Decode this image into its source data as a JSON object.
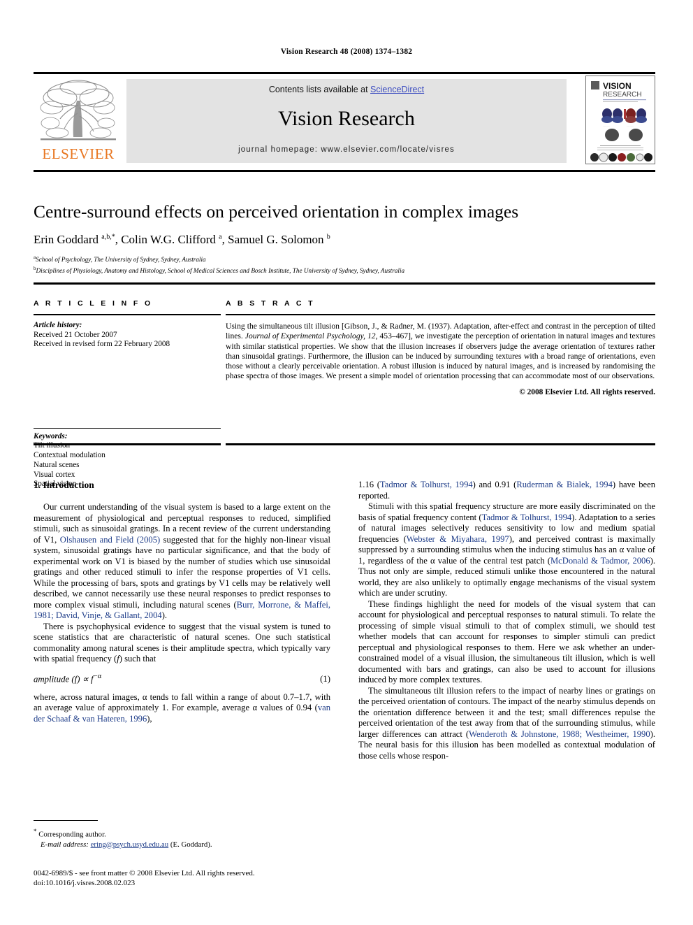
{
  "running_head": "Vision Research 48 (2008) 1374–1382",
  "masthead": {
    "publisher_logo_label": "ELSEVIER",
    "contents_prefix": "Contents lists available at ",
    "contents_link": "ScienceDirect",
    "journal_name": "Vision Research",
    "homepage_line": "journal homepage: www.elsevier.com/locate/visres",
    "cover": {
      "title_line1": "VISION",
      "title_line2": "RESEARCH"
    },
    "link_color": "#3B4CC0",
    "elsevier_orange": "#E87722"
  },
  "article": {
    "title": "Centre-surround effects on perceived orientation in complex images",
    "authors_html": "Erin Goddard <sup>a,b,*</sup>, Colin W.G. Clifford <sup>a</sup>, Samuel G. Solomon <sup>b</sup>",
    "affiliation_a": "School of Psychology, The University of Sydney, Sydney, Australia",
    "affiliation_b": "Disciplines of Physiology, Anatomy and Histology, School of Medical Sciences and Bosch Institute, The University of Sydney, Sydney, Australia"
  },
  "article_info": {
    "heading": "A R T I C L E  I N F O",
    "history_label": "Article history:",
    "history_lines": [
      "Received 21 October 2007",
      "Received in revised form 22 February 2008"
    ],
    "keywords_label": "Keywords:",
    "keywords": [
      "Tilt illusion",
      "Contextual modulation",
      "Natural scenes",
      "Visual cortex",
      "Spatial vision"
    ]
  },
  "abstract": {
    "heading": "A B S T R A C T",
    "text_html": "Using the simultaneous tilt illusion [Gibson, J., &amp; Radner, M. (1937). Adaptation, after-effect and contrast in the perception of tilted lines. <em>Journal of Experimental Psychology, 12</em>, 453–467], we investigate the perception of orientation in natural images and textures with similar statistical properties. We show that the illusion increases if observers judge the average orientation of textures rather than sinusoidal gratings. Furthermore, the illusion can be induced by surrounding textures with a broad range of orientations, even those without a clearly perceivable orientation. A robust illusion is induced by natural images, and is increased by randomising the phase spectra of those images. We present a simple model of orientation processing that can accommodate most of our observations.",
    "copyright": "© 2008 Elsevier Ltd. All rights reserved."
  },
  "body": {
    "section_title": "1. Introduction",
    "left_paragraphs_html": [
      "Our current understanding of the visual system is based to a large extent on the measurement of physiological and perceptual responses to reduced, simplified stimuli, such as sinusoidal gratings. In a recent review of the current understanding of V1, <span class=\"cite\">Olshausen and Field (2005)</span> suggested that for the highly non-linear visual system, sinusoidal gratings have no particular significance, and that the body of experimental work on V1 is biased by the number of studies which use sinusoidal gratings and other reduced stimuli to infer the response properties of V1 cells. While the processing of bars, spots and gratings by V1 cells may be relatively well described, we cannot necessarily use these neural responses to predict responses to more complex visual stimuli, including natural scenes (<span class=\"cite\">Burr, Morrone, &amp; Maffei, 1981; David, Vinje, &amp; Gallant, 2004</span>).",
      "There is psychophysical evidence to suggest that the visual system is tuned to scene statistics that are characteristic of natural scenes. One such statistical commonality among natural scenes is their amplitude spectra, which typically vary with spatial frequency (<em>f</em>) such that"
    ],
    "equation": {
      "body_html": "amplitude (f) &prop; f<sup>&minus;&alpha;</sup>",
      "number": "(1)"
    },
    "left_after_equation_html": "where, across natural images, &alpha; tends to fall within a range of about 0.7–1.7, with an average value of approximately 1. For example, average &alpha; values of 0.94 (<span class=\"cite\">van der Schaaf &amp; van Hateren, 1996</span>),",
    "right_paragraphs_html": [
      "1.16 (<span class=\"cite\">Tadmor &amp; Tolhurst, 1994</span>) and 0.91 (<span class=\"cite\">Ruderman &amp; Bialek, 1994</span>) have been reported.",
      "Stimuli with this spatial frequency structure are more easily discriminated on the basis of spatial frequency content (<span class=\"cite\">Tadmor &amp; Tolhurst, 1994</span>). Adaptation to a series of natural images selectively reduces sensitivity to low and medium spatial frequencies (<span class=\"cite\">Webster &amp; Miyahara, 1997</span>), and perceived contrast is maximally suppressed by a surrounding stimulus when the inducing stimulus has an &alpha; value of 1, regardless of the &alpha; value of the central test patch (<span class=\"cite\">McDonald &amp; Tadmor, 2006</span>). Thus not only are simple, reduced stimuli unlike those encountered in the natural world, they are also unlikely to optimally engage mechanisms of the visual system which are under scrutiny.",
      "These findings highlight the need for models of the visual system that can account for physiological and perceptual responses to natural stimuli. To relate the processing of simple visual stimuli to that of complex stimuli, we should test whether models that can account for responses to simpler stimuli can predict perceptual and physiological responses to them. Here we ask whether an under-constrained model of a visual illusion, the simultaneous tilt illusion, which is well documented with bars and gratings, can also be used to account for illusions induced by more complex textures.",
      "The simultaneous tilt illusion refers to the impact of nearby lines or gratings on the perceived orientation of contours. The impact of the nearby stimulus depends on the orientation difference between it and the test; small differences repulse the perceived orientation of the test away from that of the surrounding stimulus, while larger differences can attract (<span class=\"cite\">Wenderoth &amp; Johnstone, 1988; Westheimer, 1990</span>). The neural basis for this illusion has been modelled as contextual modulation of those cells whose respon-"
    ]
  },
  "footer": {
    "corresponding_marker": "*",
    "corresponding_label": "Corresponding author.",
    "email_label": "E-mail address:",
    "email": "ering@psych.usyd.edu.au",
    "email_owner": "(E. Goddard).",
    "issn_line": "0042-6989/$ - see front matter © 2008 Elsevier Ltd. All rights reserved.",
    "doi_line": "doi:10.1016/j.visres.2008.02.023"
  }
}
